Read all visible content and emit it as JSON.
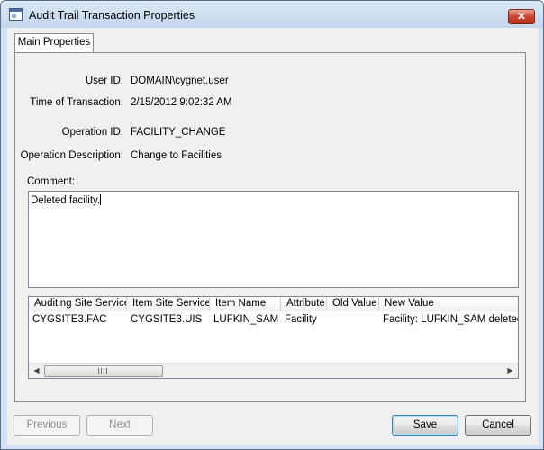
{
  "window": {
    "title": "Audit Trail Transaction Properties",
    "close_glyph": "✕",
    "icon": "window-icon"
  },
  "tabs": [
    {
      "label": "Main Properties",
      "selected": true
    }
  ],
  "fields": {
    "user_id": {
      "label": "User ID:",
      "value": "DOMAIN\\cygnet.user"
    },
    "time_of_transaction": {
      "label": "Time of Transaction:",
      "value": "2/15/2012 9:02:32 AM"
    },
    "operation_id": {
      "label": "Operation ID:",
      "value": "FACILITY_CHANGE"
    },
    "operation_description": {
      "label": "Operation Description:",
      "value": "Change to Facilities"
    }
  },
  "comment": {
    "label": "Comment:",
    "value": "Deleted facility."
  },
  "grid": {
    "columns": [
      "Auditing Site Service",
      "Item Site Service",
      "Item Name",
      "Attribute",
      "Old Value",
      "New Value"
    ],
    "rows": [
      [
        "CYGSITE3.FAC",
        "CYGSITE3.UIS",
        "LUFKIN_SAM",
        "Facility",
        "",
        "Facility: LUFKIN_SAM deleted"
      ]
    ],
    "scroll_left_glyph": "◀",
    "scroll_right_glyph": "▶"
  },
  "buttons": {
    "previous": "Previous",
    "next": "Next",
    "save": "Save",
    "cancel": "Cancel"
  },
  "colors": {
    "title_bar": "#c4d6ec",
    "close_button": "#c94331",
    "client_bg": "#f0f0f0",
    "default_button_border": "#3c7fb1"
  }
}
